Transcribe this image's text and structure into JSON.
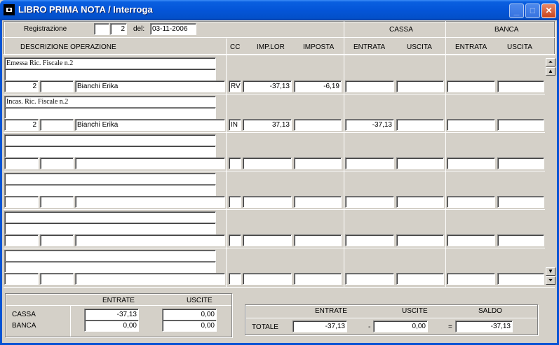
{
  "window": {
    "title": "LIBRO PRIMA NOTA / Interroga",
    "minimize_glyph": "_",
    "maximize_glyph": "□",
    "close_glyph": "✕"
  },
  "header": {
    "registrazione_label": "Registrazione",
    "registrazione_value": "2",
    "del_label": "del:",
    "date_value": "03-11-2006",
    "cassa_label": "CASSA",
    "banca_label": "BANCA"
  },
  "columns": {
    "descrizione": "DESCRIZIONE OPERAZIONE",
    "cc": "CC",
    "imp_lor": "IMP.LOR",
    "imposta": "IMPOSTA",
    "cassa_entrata": "ENTRATA",
    "cassa_uscita": "USCITA",
    "banca_entrata": "ENTRATA",
    "banca_uscita": "USCITA"
  },
  "rows": [
    {
      "desc1": "Emessa Ric. Fiscale n.2",
      "desc2": "",
      "num": "2",
      "code": "",
      "name": "Bianchi Erika",
      "cc": "RV",
      "imp_lor": "-37,13",
      "imposta": "-6,19",
      "cassa_entrata": "",
      "cassa_uscita": "",
      "banca_entrata": "",
      "banca_uscita": ""
    },
    {
      "desc1": "Incas. Ric. Fiscale n.2",
      "desc2": "",
      "num": "2",
      "code": "",
      "name": "Bianchi Erika",
      "cc": "IN",
      "imp_lor": "37,13",
      "imposta": "",
      "cassa_entrata": "-37,13",
      "cassa_uscita": "",
      "banca_entrata": "",
      "banca_uscita": ""
    },
    {
      "desc1": "",
      "desc2": "",
      "num": "",
      "code": "",
      "name": "",
      "cc": "",
      "imp_lor": "",
      "imposta": "",
      "cassa_entrata": "",
      "cassa_uscita": "",
      "banca_entrata": "",
      "banca_uscita": ""
    },
    {
      "desc1": "",
      "desc2": "",
      "num": "",
      "code": "",
      "name": "",
      "cc": "",
      "imp_lor": "",
      "imposta": "",
      "cassa_entrata": "",
      "cassa_uscita": "",
      "banca_entrata": "",
      "banca_uscita": ""
    },
    {
      "desc1": "",
      "desc2": "",
      "num": "",
      "code": "",
      "name": "",
      "cc": "",
      "imp_lor": "",
      "imposta": "",
      "cassa_entrata": "",
      "cassa_uscita": "",
      "banca_entrata": "",
      "banca_uscita": ""
    },
    {
      "desc1": "",
      "desc2": "",
      "num": "",
      "code": "",
      "name": "",
      "cc": "",
      "imp_lor": "",
      "imposta": "",
      "cassa_entrata": "",
      "cassa_uscita": "",
      "banca_entrata": "",
      "banca_uscita": ""
    }
  ],
  "summary": {
    "entrate_label": "ENTRATE",
    "uscite_label": "USCITE",
    "cassa_label": "CASSA",
    "banca_label": "BANCA",
    "cassa_entrate": "-37,13",
    "cassa_uscite": "0,00",
    "banca_entrate": "0,00",
    "banca_uscite": "0,00"
  },
  "totals": {
    "entrate_label": "ENTRATE",
    "uscite_label": "USCITE",
    "saldo_label": "SALDO",
    "totale_label": "TOTALE",
    "entrate": "-37,13",
    "minus_sign": "-",
    "uscite": "0,00",
    "equals_sign": "=",
    "saldo": "-37,13"
  },
  "scroll": {
    "top_glyph": "⏶",
    "up_glyph": "▲",
    "down_glyph": "▼",
    "bottom_glyph": "⏷"
  },
  "colors": {
    "titlebar": "#0455d8",
    "face": "#d4d0c8",
    "field": "#ffffff"
  }
}
